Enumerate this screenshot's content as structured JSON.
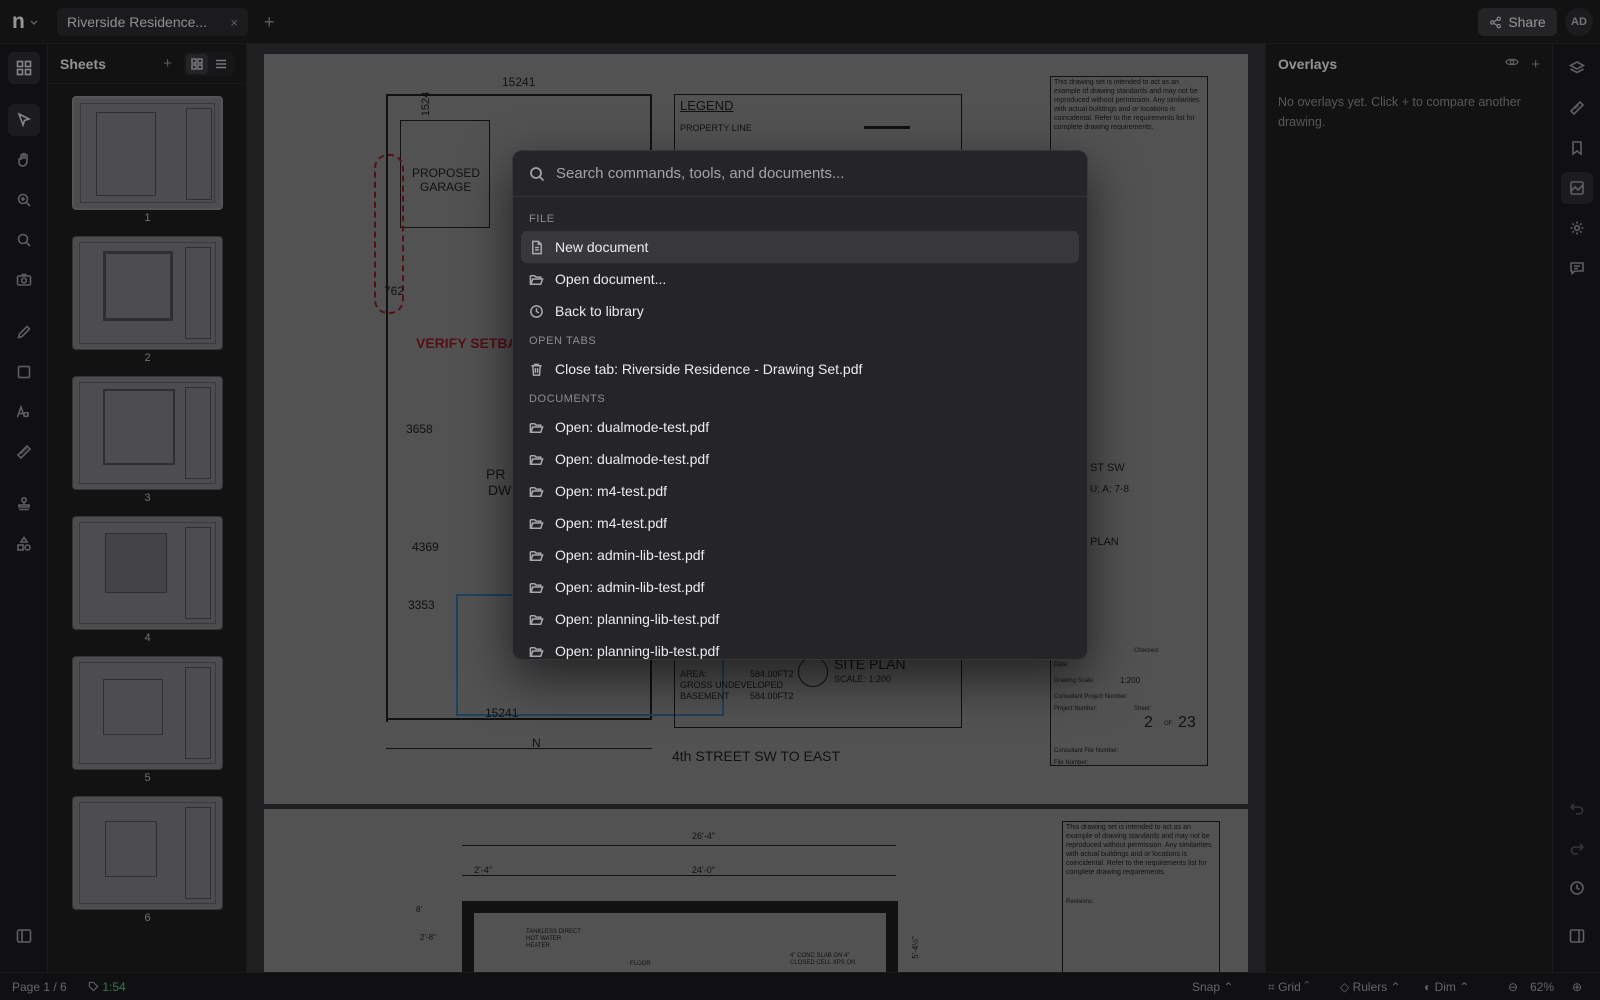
{
  "header": {
    "logo_letter": "n",
    "doc_tab_title": "Riverside Residence...",
    "close_glyph": "×",
    "new_tab_glyph": "+",
    "share_label": "Share",
    "avatar_initials": "AD"
  },
  "left_tools": [
    {
      "name": "sheets-grid-icon"
    },
    {
      "name": "select-pointer-icon"
    },
    {
      "name": "hand-pan-icon"
    },
    {
      "name": "zoom-in-icon"
    },
    {
      "name": "search-icon"
    },
    {
      "name": "camera-icon"
    },
    {
      "name": "pencil-icon"
    },
    {
      "name": "rectangle-icon"
    },
    {
      "name": "text-icon"
    },
    {
      "name": "ruler-icon"
    },
    {
      "name": "stamp-icon"
    },
    {
      "name": "shapes-icon"
    },
    {
      "name": "panel-toggle-icon"
    }
  ],
  "sheets": {
    "title": "Sheets",
    "add_glyph": "+",
    "pages": [
      "1",
      "2",
      "3",
      "4",
      "5",
      "6"
    ]
  },
  "drawing": {
    "dim_top": "15241",
    "dim_1524": "1524",
    "garage_label_1": "PROPOSED",
    "garage_label_2": "GARAGE",
    "dim_762": "762",
    "verify_text": "VERIFY SETBA",
    "dim_3658": "3658",
    "dim_4369": "4369",
    "dim_3353": "3353",
    "dim_bottom": "15241",
    "dw_partial_1": "PR",
    "dw_partial_2": "DW",
    "legend_title": "LEGEND",
    "legend_property_line": "PROPERTY LINE",
    "north": "N",
    "street": "4th STREET SW TO EAST",
    "site_plan_title": "SITE PLAN",
    "site_plan_scale": "SCALE: 1:200",
    "area_label": "AREA:",
    "area_value": "584.00FT2",
    "gross_label": "GROSS UNDEVELOPED",
    "basement_label": "BASEMENT",
    "basement_value": "584.00FT2",
    "titleblock_note": "This drawing set is intended to act as an example of drawing standards and may not be reproduced without permission. Any similarities with actual buildings and or locations is coincidental. Refer to the requirements list for complete drawing requirements.",
    "address_partial_1": "ST SW",
    "address_partial_2": "U; A; 7-8",
    "plan_partial": "PLAN",
    "drawing_scale_label": "Drawing Scale:",
    "drawing_scale": "1:200",
    "sheet_number": "2",
    "sheet_of": "OF",
    "sheet_total": "23",
    "checked_label": "Checked:",
    "date_label": "Date:",
    "project_number_label": "Project Number:",
    "sheet_label": "Sheet:",
    "consultant_file_label": "Consultant File Number:",
    "file_number_label": "File Number:",
    "consultant_project_label": "Consultant Project Number:",
    "p2_dim_top": "26'-4\"",
    "p2_dim_a": "2'-4\"",
    "p2_dim_b": "24'-0\"",
    "p2_dim_c": "2'-8\"",
    "p2_dim_d": "8'",
    "p2_tankless": "TANKLESS DIRECT\nHOT WATER\nHEATER",
    "p2_floor": "FLOOR",
    "p2_slab": "4\" CONC SLAB ON 4\"\nCLOSED CELL XPS ON",
    "p2_dim_right": "5'-4½\"",
    "p2_revisions": "Revisions:"
  },
  "overlays": {
    "title": "Overlays",
    "add_glyph": "+",
    "empty_text": "No overlays yet. Click + to compare another drawing."
  },
  "right_rail": [
    {
      "name": "layers-icon"
    },
    {
      "name": "ruler-tag-icon"
    },
    {
      "name": "bookmark-icon"
    },
    {
      "name": "overlay-compare-icon"
    },
    {
      "name": "settings-gear-icon"
    },
    {
      "name": "comment-icon"
    },
    {
      "name": "undo-icon"
    },
    {
      "name": "redo-icon"
    },
    {
      "name": "history-clock-icon"
    },
    {
      "name": "right-panel-toggle-icon"
    }
  ],
  "status": {
    "page_info": "Page 1 / 6",
    "measure_value": "1:54",
    "snap": "Snap",
    "grid": "Grid",
    "rulers": "Rulers",
    "dim": "Dim",
    "zoom": "62%"
  },
  "palette": {
    "search_placeholder": "Search commands, tools, and documents...",
    "groups": [
      {
        "label": "FILE",
        "items": [
          {
            "label": "New document",
            "icon": "new-document-icon",
            "highlighted": true
          },
          {
            "label": "Open document...",
            "icon": "folder-open-icon"
          },
          {
            "label": "Back to library",
            "icon": "clock-icon"
          }
        ]
      },
      {
        "label": "OPEN TABS",
        "items": [
          {
            "label": "Close tab: Riverside Residence - Drawing Set.pdf",
            "icon": "trash-icon"
          }
        ]
      },
      {
        "label": "DOCUMENTS",
        "items": [
          {
            "label": "Open: dualmode-test.pdf",
            "icon": "folder-open-icon"
          },
          {
            "label": "Open: dualmode-test.pdf",
            "icon": "folder-open-icon"
          },
          {
            "label": "Open: m4-test.pdf",
            "icon": "folder-open-icon"
          },
          {
            "label": "Open: m4-test.pdf",
            "icon": "folder-open-icon"
          },
          {
            "label": "Open: admin-lib-test.pdf",
            "icon": "folder-open-icon"
          },
          {
            "label": "Open: admin-lib-test.pdf",
            "icon": "folder-open-icon"
          },
          {
            "label": "Open: planning-lib-test.pdf",
            "icon": "folder-open-icon"
          },
          {
            "label": "Open: planning-lib-test.pdf",
            "icon": "folder-open-icon"
          }
        ]
      }
    ]
  }
}
